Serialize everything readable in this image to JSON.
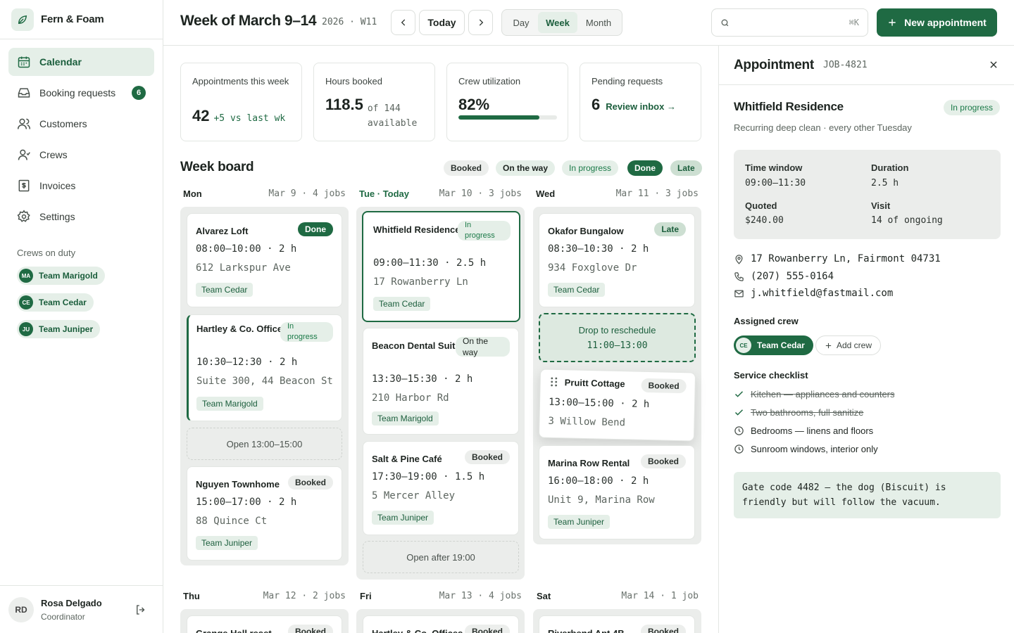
{
  "brand": {
    "name": "Fern & Foam"
  },
  "nav": [
    {
      "label": "Calendar",
      "icon": "calendar-icon",
      "active": true
    },
    {
      "label": "Booking requests",
      "icon": "inbox-icon",
      "badge": "6"
    },
    {
      "label": "Customers",
      "icon": "users-icon"
    },
    {
      "label": "Crews",
      "icon": "crew-icon"
    },
    {
      "label": "Invoices",
      "icon": "invoice-icon"
    },
    {
      "label": "Settings",
      "icon": "gear-icon"
    }
  ],
  "crews_on_duty": {
    "title": "Crews on duty",
    "items": [
      {
        "initials": "MA",
        "name": "Team Marigold"
      },
      {
        "initials": "CE",
        "name": "Team Cedar"
      },
      {
        "initials": "JU",
        "name": "Team Juniper"
      }
    ]
  },
  "user": {
    "initials": "RD",
    "name": "Rosa Delgado",
    "role": "Coordinator"
  },
  "topbar": {
    "title": "Week of March 9–14",
    "subtitle": "2026 · W11",
    "today": "Today",
    "views": [
      "Day",
      "Week",
      "Month"
    ],
    "active_view": "Week",
    "search": {
      "placeholder": "",
      "shortcut": "⌘K"
    },
    "new_button": "New appointment"
  },
  "stats": [
    {
      "label": "Appointments this week",
      "value": "42",
      "extra": "+5 vs last wk"
    },
    {
      "label": "Hours booked",
      "value": "118.5",
      "extra": "of 144 available"
    },
    {
      "label": "Crew utilization",
      "value": "82%",
      "progress": 0.82
    },
    {
      "label": "Pending requests",
      "value": "6",
      "link": "Review inbox →"
    }
  ],
  "board": {
    "title": "Week board",
    "legend": [
      "Booked",
      "On the way",
      "In progress",
      "Done",
      "Late"
    ]
  },
  "days": [
    {
      "label": "Mon",
      "date": "Mar 9 · 4 jobs"
    },
    {
      "label": "Tue · Today",
      "date": "Mar 10 · 3 jobs"
    },
    {
      "label": "Wed",
      "date": "Mar 11 · 3 jobs"
    },
    {
      "label": "Thu",
      "date": "Mar 12 · 2 jobs"
    },
    {
      "label": "Fri",
      "date": "Mar 13 · 4 jobs"
    },
    {
      "label": "Sat",
      "date": "Mar 14 · 1 job"
    }
  ],
  "mon": [
    {
      "name": "Alvarez Loft",
      "status": "Done",
      "time": "08:00–10:00 · 2 h",
      "addr": "612 Larkspur Ave",
      "team": "Team Cedar"
    },
    {
      "name": "Hartley & Co. Offices",
      "status": "In progress",
      "time": "10:30–12:30 · 2 h",
      "addr": "Suite 300, 44 Beacon St",
      "team": "Team Marigold"
    },
    {
      "name": "Nguyen Townhome",
      "status": "Booked",
      "time": "15:00–17:00 · 2 h",
      "addr": "88 Quince Ct",
      "team": "Team Juniper"
    }
  ],
  "mon_open": "Open 13:00–15:00",
  "tue": [
    {
      "name": "Whitfield Residence",
      "status": "In progress",
      "time": "09:00–11:30 · 2.5 h",
      "addr": "17 Rowanberry Ln",
      "team": "Team Cedar"
    },
    {
      "name": "Beacon Dental Suite",
      "status": "On the way",
      "time": "13:30–15:30 · 2 h",
      "addr": "210 Harbor Rd",
      "team": "Team Marigold"
    },
    {
      "name": "Salt & Pine Café",
      "status": "Booked",
      "time": "17:30–19:00 · 1.5 h",
      "addr": "5 Mercer Alley",
      "team": "Team Juniper"
    }
  ],
  "tue_open": "Open after 19:00",
  "wed": [
    {
      "name": "Okafor Bungalow",
      "status": "Late",
      "time": "08:30–10:30 · 2 h",
      "addr": "934 Foxglove Dr",
      "team": "Team Cedar"
    },
    {
      "name": "Pruitt Cottage",
      "status": "Booked",
      "time": "13:00–15:00 · 2 h",
      "addr": "3 Willow Bend"
    },
    {
      "name": "Marina Row Rental",
      "status": "Booked",
      "time": "16:00–18:00 · 2 h",
      "addr": "Unit 9, Marina Row",
      "team": "Team Juniper"
    }
  ],
  "drop": {
    "label": "Drop to reschedule",
    "time": "11:00–13:00"
  },
  "lower": [
    {
      "name": "Grange Hall reset",
      "status": "Booked"
    },
    {
      "name": "Hartley & Co. Offices",
      "status": "Booked"
    },
    {
      "name": "Riverbend Apt 4B",
      "status": "Booked"
    }
  ],
  "detail": {
    "title": "Appointment",
    "job": "JOB-4821",
    "name": "Whitfield Residence",
    "status": "In progress",
    "sub": "Recurring deep clean · every other Tuesday",
    "time_window_label": "Time window",
    "time_window": "09:00–11:30",
    "duration_label": "Duration",
    "duration": "2.5 h",
    "quoted_label": "Quoted",
    "quoted": "$240.00",
    "visit_label": "Visit",
    "visit": "14 of ongoing",
    "address": "17 Rowanberry Ln, Fairmont 04731",
    "phone": "(207) 555-0164",
    "email": "j.whitfield@fastmail.com",
    "assigned_label": "Assigned crew",
    "crew": {
      "initials": "CE",
      "name": "Team Cedar"
    },
    "add_crew": "Add crew",
    "checklist_label": "Service checklist",
    "checklist": [
      {
        "text": "Kitchen — appliances and counters",
        "done": true
      },
      {
        "text": "Two bathrooms, full sanitize",
        "done": true
      },
      {
        "text": "Bedrooms — linens and floors",
        "done": false
      },
      {
        "text": "Sunroom windows, interior only",
        "done": false
      }
    ],
    "note": "Gate code 4482 — the dog (Biscuit) is friendly but will follow the vacuum."
  }
}
